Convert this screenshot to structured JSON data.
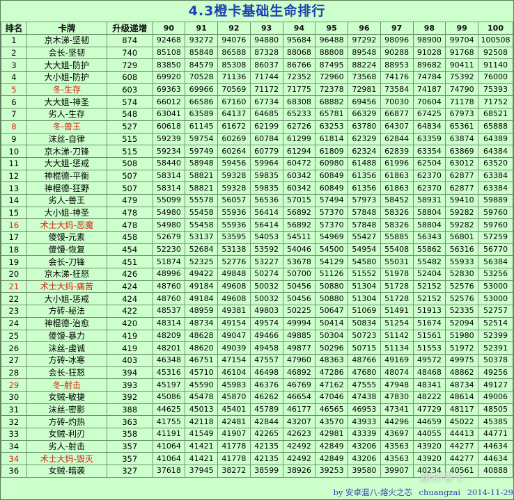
{
  "title": "4.3橙卡基础生命排行",
  "headers": [
    "排名",
    "卡牌",
    "升级递增",
    "90",
    "91",
    "92",
    "93",
    "94",
    "95",
    "96",
    "97",
    "98",
    "99",
    "100"
  ],
  "highlight_color": "#e02010",
  "rows": [
    {
      "rank": "1",
      "name": "京木涕-坚韧",
      "inc": "874",
      "vals": [
        "92468",
        "93272",
        "94076",
        "94880",
        "95684",
        "96488",
        "97292",
        "98096",
        "98900",
        "99704",
        "100508"
      ],
      "red": false
    },
    {
      "rank": "2",
      "name": "会长-坚韧",
      "inc": "740",
      "vals": [
        "85108",
        "85848",
        "86588",
        "87328",
        "88068",
        "88808",
        "89548",
        "90288",
        "91028",
        "91768",
        "92508"
      ],
      "red": false
    },
    {
      "rank": "3",
      "name": "大大姐-防护",
      "inc": "729",
      "vals": [
        "83850",
        "84579",
        "85308",
        "86037",
        "86766",
        "87495",
        "88224",
        "88953",
        "89682",
        "90411",
        "91140"
      ],
      "red": false
    },
    {
      "rank": "4",
      "name": "大小姐-防护",
      "inc": "608",
      "vals": [
        "69920",
        "70528",
        "71136",
        "71744",
        "72352",
        "72960",
        "73568",
        "74176",
        "74784",
        "75392",
        "76000"
      ],
      "red": false
    },
    {
      "rank": "5",
      "name": "冬-生存",
      "inc": "603",
      "vals": [
        "69363",
        "69966",
        "70569",
        "71172",
        "71775",
        "72378",
        "72981",
        "73584",
        "74187",
        "74790",
        "75393"
      ],
      "red": true
    },
    {
      "rank": "6",
      "name": "大大姐-神圣",
      "inc": "574",
      "vals": [
        "66012",
        "66586",
        "67160",
        "67734",
        "68308",
        "68882",
        "69456",
        "70030",
        "70604",
        "71178",
        "71752"
      ],
      "red": false
    },
    {
      "rank": "7",
      "name": "劣人-生存",
      "inc": "548",
      "vals": [
        "63041",
        "63589",
        "64137",
        "64685",
        "65233",
        "65781",
        "66329",
        "66877",
        "67425",
        "67973",
        "68521"
      ],
      "red": false
    },
    {
      "rank": "8",
      "name": "冬-兽王",
      "inc": "527",
      "vals": [
        "60618",
        "61145",
        "61672",
        "62199",
        "62726",
        "63253",
        "63780",
        "64307",
        "64834",
        "65361",
        "65888"
      ],
      "red": true
    },
    {
      "rank": "9",
      "name": "沫丝-自律",
      "inc": "515",
      "vals": [
        "59239",
        "59754",
        "60269",
        "60784",
        "61299",
        "61814",
        "62329",
        "62844",
        "63359",
        "63874",
        "64389"
      ],
      "red": false
    },
    {
      "rank": "10",
      "name": "京木涕-刀锋",
      "inc": "515",
      "vals": [
        "59234",
        "59749",
        "60264",
        "60779",
        "61294",
        "61809",
        "62324",
        "62839",
        "63354",
        "63869",
        "64384"
      ],
      "red": false
    },
    {
      "rank": "11",
      "name": "大大姐-惩戒",
      "inc": "508",
      "vals": [
        "58440",
        "58948",
        "59456",
        "59964",
        "60472",
        "60980",
        "61488",
        "61996",
        "62504",
        "63012",
        "63520"
      ],
      "red": false
    },
    {
      "rank": "12",
      "name": "神棍德-平衡",
      "inc": "507",
      "vals": [
        "58314",
        "58821",
        "59328",
        "59835",
        "60342",
        "60849",
        "61356",
        "61863",
        "62370",
        "62877",
        "63384"
      ],
      "red": false
    },
    {
      "rank": "13",
      "name": "神棍德-狂野",
      "inc": "507",
      "vals": [
        "58314",
        "58821",
        "59328",
        "59835",
        "60342",
        "60849",
        "61356",
        "61863",
        "62370",
        "62877",
        "63384"
      ],
      "red": false
    },
    {
      "rank": "14",
      "name": "劣人-兽王",
      "inc": "479",
      "vals": [
        "55099",
        "55578",
        "56057",
        "56536",
        "57015",
        "57494",
        "57973",
        "58452",
        "58931",
        "59410",
        "59889"
      ],
      "red": false
    },
    {
      "rank": "15",
      "name": "大小姐-神圣",
      "inc": "478",
      "vals": [
        "54980",
        "55458",
        "55936",
        "56414",
        "56892",
        "57370",
        "57848",
        "58326",
        "58804",
        "59282",
        "59760"
      ],
      "red": false
    },
    {
      "rank": "16",
      "name": "术士大妈-恶魔",
      "inc": "478",
      "vals": [
        "54980",
        "55458",
        "55936",
        "56414",
        "56892",
        "57370",
        "57848",
        "58326",
        "58804",
        "59282",
        "59760"
      ],
      "red": true
    },
    {
      "rank": "17",
      "name": "傻馒-元素",
      "inc": "458",
      "vals": [
        "52679",
        "53137",
        "53595",
        "54053",
        "54511",
        "54969",
        "55427",
        "55885",
        "56343",
        "56801",
        "57259"
      ],
      "red": false
    },
    {
      "rank": "18",
      "name": "傻馒-恢复",
      "inc": "454",
      "vals": [
        "52230",
        "52684",
        "53138",
        "53592",
        "54046",
        "54500",
        "54954",
        "55408",
        "55862",
        "56316",
        "56770"
      ],
      "red": false
    },
    {
      "rank": "19",
      "name": "会长-刀锋",
      "inc": "451",
      "vals": [
        "51874",
        "52325",
        "52776",
        "53227",
        "53678",
        "54129",
        "54580",
        "55031",
        "55482",
        "55933",
        "56384"
      ],
      "red": false
    },
    {
      "rank": "20",
      "name": "京木涕-狂怒",
      "inc": "426",
      "vals": [
        "48996",
        "49422",
        "49848",
        "50274",
        "50700",
        "51126",
        "51552",
        "51978",
        "52404",
        "52830",
        "53256"
      ],
      "red": false
    },
    {
      "rank": "21",
      "name": "术士大妈-痛苦",
      "inc": "424",
      "vals": [
        "48760",
        "49184",
        "49608",
        "50032",
        "50456",
        "50880",
        "51304",
        "51728",
        "52152",
        "52576",
        "53000"
      ],
      "red": true
    },
    {
      "rank": "22",
      "name": "大小姐-惩戒",
      "inc": "424",
      "vals": [
        "48760",
        "49184",
        "49608",
        "50032",
        "50456",
        "50880",
        "51304",
        "51728",
        "52152",
        "52576",
        "53000"
      ],
      "red": false
    },
    {
      "rank": "23",
      "name": "方砖-秘法",
      "inc": "422",
      "vals": [
        "48537",
        "48959",
        "49381",
        "49803",
        "50225",
        "50647",
        "51069",
        "51491",
        "51913",
        "52335",
        "52757"
      ],
      "red": false
    },
    {
      "rank": "24",
      "name": "神棍德-治愈",
      "inc": "420",
      "vals": [
        "48314",
        "48734",
        "49154",
        "49574",
        "49994",
        "50414",
        "50834",
        "51254",
        "51674",
        "52094",
        "52514"
      ],
      "red": false
    },
    {
      "rank": "25",
      "name": "傻馒-暴力",
      "inc": "419",
      "vals": [
        "48209",
        "48628",
        "49047",
        "49466",
        "49885",
        "50304",
        "50723",
        "51142",
        "51561",
        "51980",
        "52399"
      ],
      "red": false
    },
    {
      "rank": "26",
      "name": "沫丝-虔诚",
      "inc": "419",
      "vals": [
        "48201",
        "48620",
        "49039",
        "49458",
        "49877",
        "50296",
        "50715",
        "51134",
        "51553",
        "51972",
        "52391"
      ],
      "red": false
    },
    {
      "rank": "27",
      "name": "方砖-冰寒",
      "inc": "403",
      "vals": [
        "46348",
        "46751",
        "47154",
        "47557",
        "47960",
        "48363",
        "48766",
        "49169",
        "49572",
        "49975",
        "50378"
      ],
      "red": false
    },
    {
      "rank": "28",
      "name": "会长-狂怒",
      "inc": "394",
      "vals": [
        "45316",
        "45710",
        "46104",
        "46498",
        "46892",
        "47286",
        "47680",
        "48074",
        "48468",
        "48862",
        "49256"
      ],
      "red": false
    },
    {
      "rank": "29",
      "name": "冬-射击",
      "inc": "393",
      "vals": [
        "45197",
        "45590",
        "45983",
        "46376",
        "46769",
        "47162",
        "47555",
        "47948",
        "48341",
        "48734",
        "49127"
      ],
      "red": true
    },
    {
      "rank": "30",
      "name": "女贼-敏捷",
      "inc": "392",
      "vals": [
        "45086",
        "45478",
        "45870",
        "46262",
        "46654",
        "47046",
        "47438",
        "47830",
        "48222",
        "48614",
        "49006"
      ],
      "red": false
    },
    {
      "rank": "31",
      "name": "沫丝-密影",
      "inc": "388",
      "vals": [
        "44625",
        "45013",
        "45401",
        "45789",
        "46177",
        "46565",
        "46953",
        "47341",
        "47729",
        "48117",
        "48505"
      ],
      "red": false
    },
    {
      "rank": "32",
      "name": "方砖-灼热",
      "inc": "363",
      "vals": [
        "41755",
        "42118",
        "42481",
        "42844",
        "43207",
        "43570",
        "43933",
        "44296",
        "44659",
        "45022",
        "45385"
      ],
      "red": false
    },
    {
      "rank": "33",
      "name": "女贼-利刃",
      "inc": "358",
      "vals": [
        "41191",
        "41549",
        "41907",
        "42265",
        "42623",
        "42981",
        "43339",
        "43697",
        "44055",
        "44413",
        "44771"
      ],
      "red": false
    },
    {
      "rank": "34",
      "name": "劣人-射击",
      "inc": "357",
      "vals": [
        "41064",
        "41421",
        "41778",
        "42135",
        "42492",
        "42849",
        "43206",
        "43563",
        "43920",
        "44277",
        "44634"
      ],
      "red": false
    },
    {
      "rank": "34",
      "name": "术士大妈-毁灭",
      "inc": "357",
      "vals": [
        "41064",
        "41421",
        "41778",
        "42135",
        "42492",
        "42849",
        "43206",
        "43563",
        "43920",
        "44277",
        "44634"
      ],
      "red": true
    },
    {
      "rank": "36",
      "name": "女贼-暗袭",
      "inc": "327",
      "vals": [
        "37618",
        "37945",
        "38272",
        "38599",
        "38926",
        "39253",
        "39580",
        "39907",
        "40234",
        "40561",
        "40888"
      ],
      "red": false
    }
  ],
  "footer": {
    "by": "by 安卓混八-熔火之芯",
    "user": "chuangzai",
    "date": "2014-11-29"
  },
  "watermark": "超神导卡"
}
